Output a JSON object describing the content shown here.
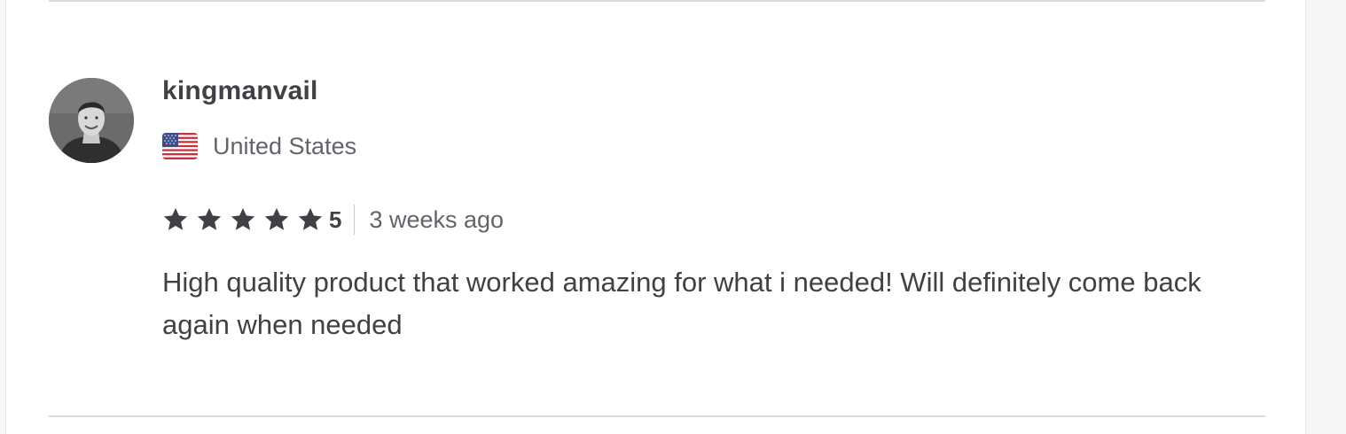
{
  "review": {
    "username": "kingmanvail",
    "country": "United States",
    "country_flag_icon": "us-flag-icon",
    "rating": {
      "stars": 5,
      "max": 5,
      "value_text": "5",
      "star_color": "#404145"
    },
    "time_ago": "3 weeks ago",
    "text": "High quality product that worked amazing for what i needed! Will definitely come back again when needed"
  }
}
